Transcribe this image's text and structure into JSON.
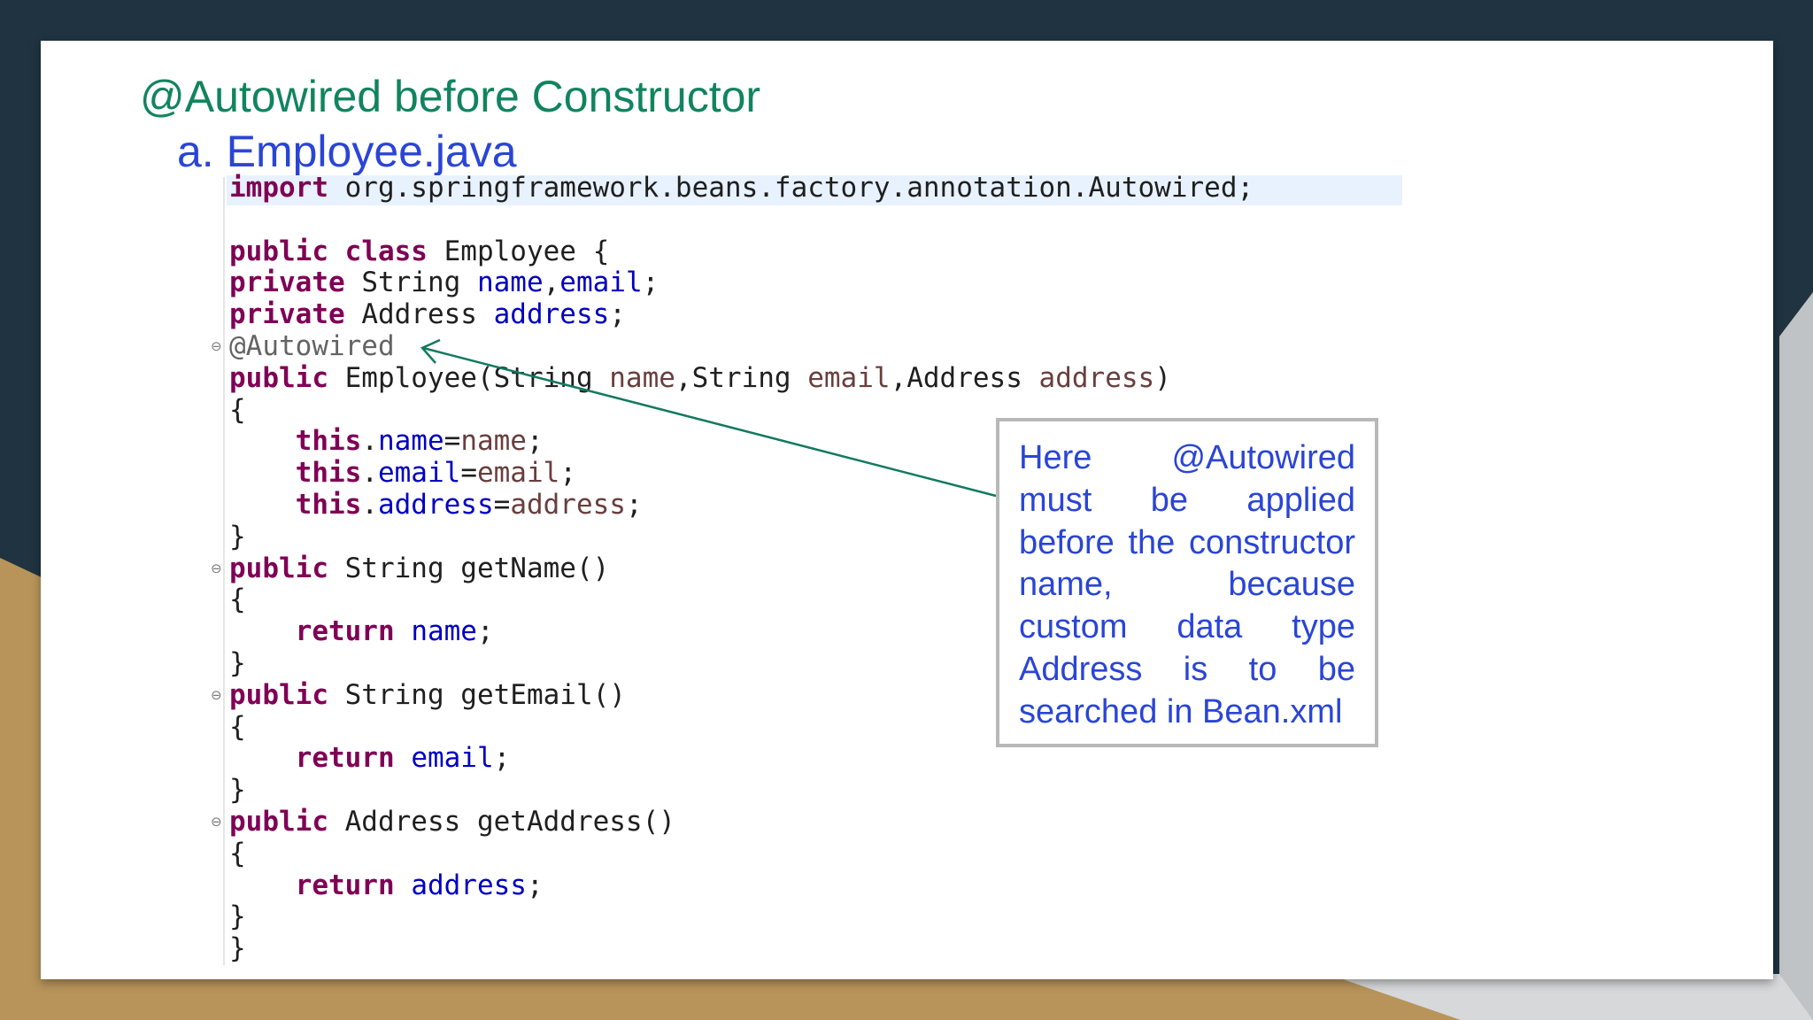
{
  "slide": {
    "title": "@Autowired before Constructor",
    "subtitle": "a. Employee.java"
  },
  "code": {
    "lines": [
      [
        {
          "t": "import",
          "c": "kw"
        },
        {
          "t": " org.springframework.beans.factory.annotation.Autowired;",
          "c": ""
        }
      ],
      [],
      [
        {
          "t": "public",
          "c": "kw"
        },
        {
          "t": " ",
          "c": ""
        },
        {
          "t": "class",
          "c": "kw"
        },
        {
          "t": " Employee {",
          "c": ""
        }
      ],
      [
        {
          "t": "private",
          "c": "kw"
        },
        {
          "t": " String ",
          "c": ""
        },
        {
          "t": "name",
          "c": "fld"
        },
        {
          "t": ",",
          "c": ""
        },
        {
          "t": "email",
          "c": "fld"
        },
        {
          "t": ";",
          "c": ""
        }
      ],
      [
        {
          "t": "private",
          "c": "kw"
        },
        {
          "t": " Address ",
          "c": ""
        },
        {
          "t": "address",
          "c": "fld"
        },
        {
          "t": ";",
          "c": ""
        }
      ],
      [
        {
          "t": "@Autowired",
          "c": "ann"
        }
      ],
      [
        {
          "t": "public",
          "c": "kw"
        },
        {
          "t": " Employee(String ",
          "c": ""
        },
        {
          "t": "name",
          "c": "par"
        },
        {
          "t": ",String ",
          "c": ""
        },
        {
          "t": "email",
          "c": "par"
        },
        {
          "t": ",Address ",
          "c": ""
        },
        {
          "t": "address",
          "c": "par"
        },
        {
          "t": ")",
          "c": ""
        }
      ],
      [
        {
          "t": "{",
          "c": ""
        }
      ],
      [
        {
          "t": "    ",
          "c": ""
        },
        {
          "t": "this",
          "c": "kw"
        },
        {
          "t": ".",
          "c": ""
        },
        {
          "t": "name",
          "c": "fld"
        },
        {
          "t": "=",
          "c": ""
        },
        {
          "t": "name",
          "c": "par"
        },
        {
          "t": ";",
          "c": ""
        }
      ],
      [
        {
          "t": "    ",
          "c": ""
        },
        {
          "t": "this",
          "c": "kw"
        },
        {
          "t": ".",
          "c": ""
        },
        {
          "t": "email",
          "c": "fld"
        },
        {
          "t": "=",
          "c": ""
        },
        {
          "t": "email",
          "c": "par"
        },
        {
          "t": ";",
          "c": ""
        }
      ],
      [
        {
          "t": "    ",
          "c": ""
        },
        {
          "t": "this",
          "c": "kw"
        },
        {
          "t": ".",
          "c": ""
        },
        {
          "t": "address",
          "c": "fld"
        },
        {
          "t": "=",
          "c": ""
        },
        {
          "t": "address",
          "c": "par"
        },
        {
          "t": ";",
          "c": ""
        }
      ],
      [
        {
          "t": "}",
          "c": ""
        }
      ],
      [
        {
          "t": "public",
          "c": "kw"
        },
        {
          "t": " String getName()",
          "c": ""
        }
      ],
      [
        {
          "t": "{",
          "c": ""
        }
      ],
      [
        {
          "t": "    ",
          "c": ""
        },
        {
          "t": "return",
          "c": "kw"
        },
        {
          "t": " ",
          "c": ""
        },
        {
          "t": "name",
          "c": "fld"
        },
        {
          "t": ";",
          "c": ""
        }
      ],
      [
        {
          "t": "}",
          "c": ""
        }
      ],
      [
        {
          "t": "public",
          "c": "kw"
        },
        {
          "t": " String getEmail()",
          "c": ""
        }
      ],
      [
        {
          "t": "{",
          "c": ""
        }
      ],
      [
        {
          "t": "    ",
          "c": ""
        },
        {
          "t": "return",
          "c": "kw"
        },
        {
          "t": " ",
          "c": ""
        },
        {
          "t": "email",
          "c": "fld"
        },
        {
          "t": ";",
          "c": ""
        }
      ],
      [
        {
          "t": "}",
          "c": ""
        }
      ],
      [
        {
          "t": "public",
          "c": "kw"
        },
        {
          "t": " Address getAddress()",
          "c": ""
        }
      ],
      [
        {
          "t": "{",
          "c": ""
        }
      ],
      [
        {
          "t": "    ",
          "c": ""
        },
        {
          "t": "return",
          "c": "kw"
        },
        {
          "t": " ",
          "c": ""
        },
        {
          "t": "address",
          "c": "fld"
        },
        {
          "t": ";",
          "c": ""
        }
      ],
      [
        {
          "t": "}",
          "c": ""
        }
      ],
      [
        {
          "t": "}",
          "c": ""
        }
      ]
    ],
    "fold_markers": [
      {
        "line": 5,
        "symbol": "⊖"
      },
      {
        "line": 12,
        "symbol": "⊖"
      },
      {
        "line": 16,
        "symbol": "⊖"
      },
      {
        "line": 20,
        "symbol": "⊖"
      }
    ]
  },
  "callout": {
    "text": "Here @Autowired must be applied before the constructor name, because custom data type Address is to be searched in Bean.xml"
  },
  "colors": {
    "title": "#11845e",
    "subtitle": "#2a45d6",
    "keyword": "#7f0055",
    "field": "#0000c0",
    "parameter": "#6a3e3e",
    "annotation": "#646464",
    "arrow": "#117a5e"
  }
}
